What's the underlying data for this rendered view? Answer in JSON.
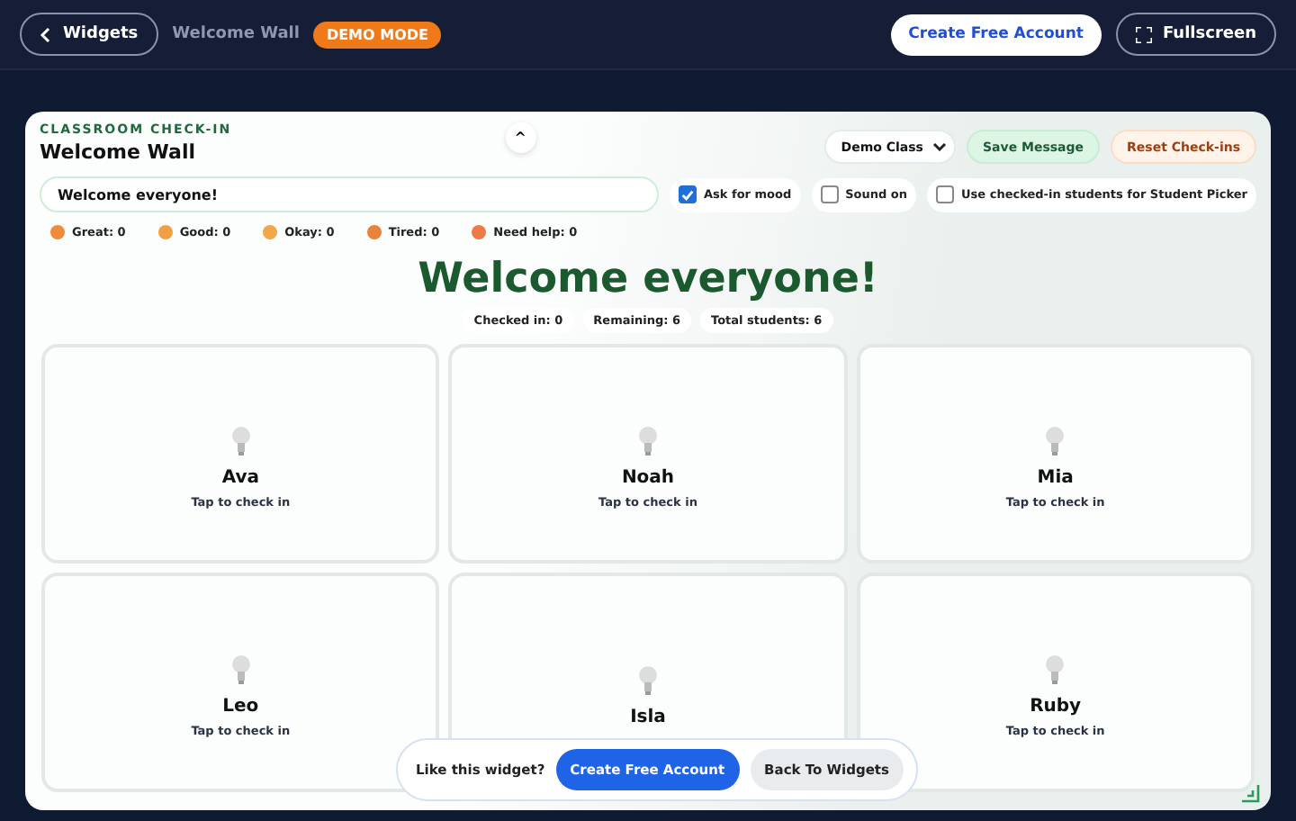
{
  "topbar": {
    "back": "Widgets",
    "title": "Welcome Wall",
    "badge": "DEMO MODE",
    "create": "Create Free Account",
    "fullscreen": "Fullscreen"
  },
  "widget": {
    "eyebrow": "CLASSROOM CHECK-IN",
    "title": "Welcome Wall",
    "collapse": "^",
    "class_select": "Demo Class",
    "save": "Save Message",
    "reset": "Reset Check-ins",
    "message": "Welcome everyone!",
    "options": [
      {
        "label": "Ask for mood",
        "checked": true
      },
      {
        "label": "Sound on",
        "checked": false
      },
      {
        "label": "Use checked-in students for Student Picker",
        "checked": false
      }
    ],
    "moods": [
      {
        "label": "Great: 0",
        "color": "#f08a3c"
      },
      {
        "label": "Good: 0",
        "color": "#f0a040"
      },
      {
        "label": "Okay: 0",
        "color": "#f0a848"
      },
      {
        "label": "Tired: 0",
        "color": "#e8843a"
      },
      {
        "label": "Need help: 0",
        "color": "#ee7a48"
      }
    ],
    "heading": "Welcome everyone!",
    "stats": [
      "Checked in: 0",
      "Remaining: 6",
      "Total students: 6"
    ],
    "students": [
      {
        "name": "Ava",
        "hint": "Tap to check in"
      },
      {
        "name": "Noah",
        "hint": "Tap to check in"
      },
      {
        "name": "Mia",
        "hint": "Tap to check in"
      },
      {
        "name": "Leo",
        "hint": "Tap to check in"
      },
      {
        "name": "Isla"
      },
      {
        "name": "Ruby",
        "hint": "Tap to check in"
      }
    ]
  },
  "promo": {
    "text": "Like this widget?",
    "create": "Create Free Account",
    "back": "Back To Widgets"
  }
}
